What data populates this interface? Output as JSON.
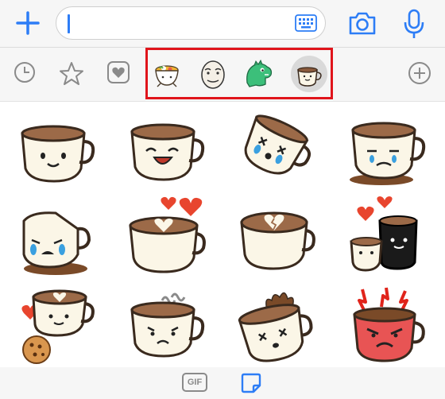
{
  "composer": {
    "input_value": "",
    "icons": [
      "plus-icon",
      "keyboard-icon",
      "camera-icon",
      "microphone-icon"
    ]
  },
  "tray": {
    "icons": [
      "recent-clock-icon",
      "favorites-star-icon",
      "heart-pack-icon",
      "ramen-pack-icon",
      "face-pack-icon",
      "dinosaur-pack-icon",
      "coffee-pack-icon",
      "add-pack-icon"
    ],
    "selected_pack": "coffee-pack-icon"
  },
  "stickers": [
    {
      "name": "coffee-smile"
    },
    {
      "name": "coffee-laugh"
    },
    {
      "name": "coffee-tipsy"
    },
    {
      "name": "coffee-sad"
    },
    {
      "name": "coffee-crying"
    },
    {
      "name": "coffee-love-hearts"
    },
    {
      "name": "coffee-broken-heart"
    },
    {
      "name": "coffee-couple"
    },
    {
      "name": "coffee-cookie"
    },
    {
      "name": "coffee-frown"
    },
    {
      "name": "coffee-splash"
    },
    {
      "name": "coffee-angry"
    }
  ],
  "bottom": {
    "gif_label": "GIF"
  },
  "colors": {
    "accent": "#2d7df6",
    "highlight_box": "#e0141b",
    "icon_gray": "#8a8a8a"
  }
}
